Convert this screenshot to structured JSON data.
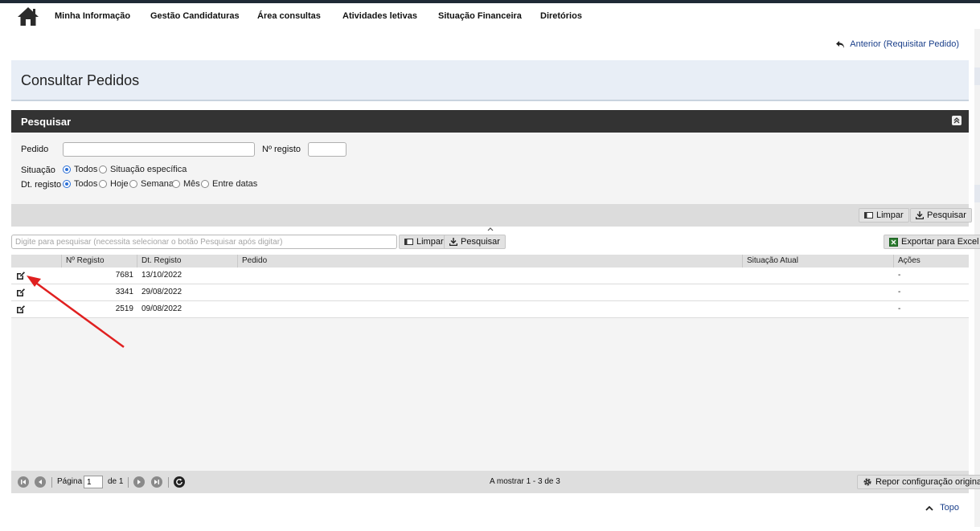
{
  "nav": {
    "items": [
      "Minha Informação",
      "Gestão Candidaturas",
      "Área consultas",
      "Atividades letivas",
      "Situação Financeira",
      "Diretórios"
    ]
  },
  "back_link": "Anterior (Requisitar Pedido)",
  "page_title": "Consultar Pedidos",
  "search_panel": {
    "title": "Pesquisar",
    "pedido_label": "Pedido",
    "registo_label": "Nº registo",
    "situacao_label": "Situação",
    "situacao_options": [
      "Todos",
      "Situação específica"
    ],
    "dt_label": "Dt. registo",
    "dt_options": [
      "Todos",
      "Hoje",
      "Semana",
      "Mês",
      "Entre datas"
    ],
    "clear_label": "Limpar",
    "search_label": "Pesquisar"
  },
  "grid_toolbar": {
    "search_placeholder": "Digite para pesquisar (necessita selecionar o botão Pesquisar após digitar)",
    "clear_label": "Limpar",
    "search_label": "Pesquisar",
    "export_label": "Exportar para Excel"
  },
  "table": {
    "columns": [
      "Nº Registo",
      "Dt. Registo",
      "Pedido",
      "Situação Atual",
      "Ações"
    ],
    "rows": [
      {
        "registo": "7681",
        "data": "13/10/2022",
        "pedido": "",
        "situacao": "",
        "acoes": "-"
      },
      {
        "registo": "3341",
        "data": "29/08/2022",
        "pedido": "",
        "situacao": "",
        "acoes": "-"
      },
      {
        "registo": "2519",
        "data": "09/08/2022",
        "pedido": "",
        "situacao": "",
        "acoes": "-"
      }
    ]
  },
  "pager": {
    "page_label": "Página",
    "page_value": "1",
    "of_label": "de 1",
    "showing": "A mostrar 1 - 3 de 3",
    "reset_label": "Repor configuração original"
  },
  "top_link": "Topo",
  "colors": {
    "accent_link": "#1a3f8a",
    "panel_header": "#333333",
    "annotation_arrow": "#e02020"
  }
}
